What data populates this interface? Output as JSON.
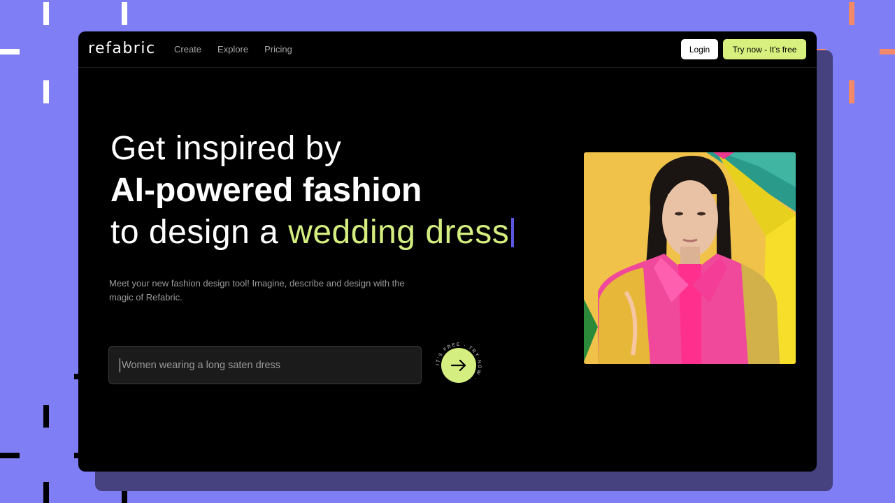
{
  "nav": {
    "logo": "refabric",
    "links": [
      "Create",
      "Explore",
      "Pricing"
    ],
    "login_label": "Login",
    "try_label": "Try now - It's free"
  },
  "hero": {
    "line1": "Get inspired by",
    "line2": "AI-powered fashion",
    "line3_prefix": "to design a ",
    "line3_accent": "wedding dress",
    "description": "Meet your new fashion design tool! Imagine, describe and design with the magic of Refabric."
  },
  "prompt": {
    "placeholder": "Women wearing a long saten dress",
    "value": ""
  },
  "submit": {
    "ring_text": "IT'S FREE · TRY NOW · "
  },
  "colors": {
    "background": "#7f7ef5",
    "accent": "#d4ee7f",
    "window": "#000000"
  }
}
